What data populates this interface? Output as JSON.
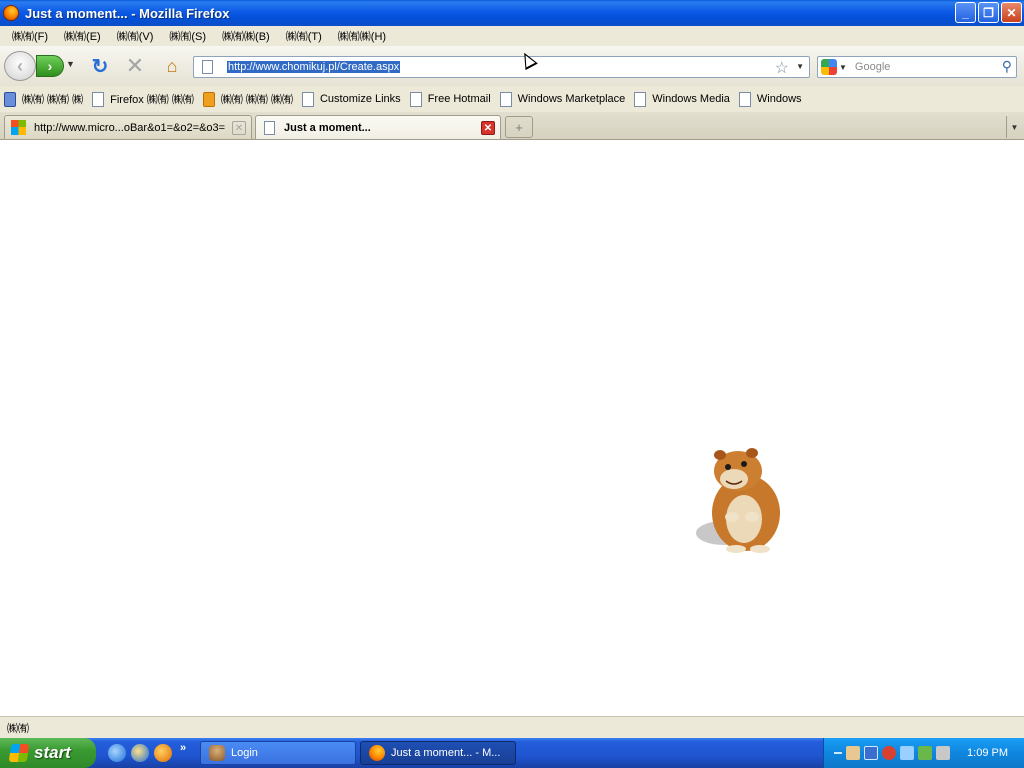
{
  "window": {
    "title": "Just a moment... - Mozilla Firefox",
    "min_label": "_",
    "max_label": "❐",
    "close_label": "✕"
  },
  "menubar": {
    "items": [
      "㈱㈲(F)",
      "㈱㈲(E)",
      "㈱㈲(V)",
      "㈱㈲(S)",
      "㈱㈲㈱(B)",
      "㈱㈲(T)",
      "㈱㈲㈱(H)"
    ]
  },
  "toolbar": {
    "back_icon": "‹",
    "forward_icon": "›",
    "reload_icon": "↻",
    "stop_icon": "✕",
    "home_icon": "⌂",
    "url": "http://www.chomikuj.pl/Create.aspx",
    "search_placeholder": "Google"
  },
  "bookmarks": {
    "items": [
      {
        "label": "㈱㈲ ㈱㈲ ㈱",
        "icon": "blue"
      },
      {
        "label": "Firefox ㈱㈲ ㈱㈲",
        "icon": "page"
      },
      {
        "label": "㈱㈲ ㈱㈲ ㈱㈲",
        "icon": "rss"
      },
      {
        "label": "Customize Links",
        "icon": "page"
      },
      {
        "label": "Free Hotmail",
        "icon": "page"
      },
      {
        "label": "Windows Marketplace",
        "icon": "page"
      },
      {
        "label": "Windows Media",
        "icon": "page"
      },
      {
        "label": "Windows",
        "icon": "page"
      }
    ]
  },
  "tabs": {
    "items": [
      {
        "label": "http://www.micro...oBar&o1=&o2=&o3=",
        "active": false
      },
      {
        "label": "Just a moment...",
        "active": true
      }
    ],
    "new_tab_label": "+"
  },
  "content": {
    "image": "hamster-animation"
  },
  "status": {
    "text": "㈱㈲"
  },
  "taskbar": {
    "start_label": "start",
    "more_label": "»",
    "tasks": [
      {
        "label": "Login",
        "active": false
      },
      {
        "label": "Just a moment... - M...",
        "active": true
      }
    ],
    "clock": "1:09 PM"
  },
  "colors": {
    "title_bar": "#0c5ae6",
    "taskbar": "#245edc",
    "start_button": "#3a9b32",
    "url_selection": "#316ac5",
    "chrome_bg": "#ece9d8"
  }
}
